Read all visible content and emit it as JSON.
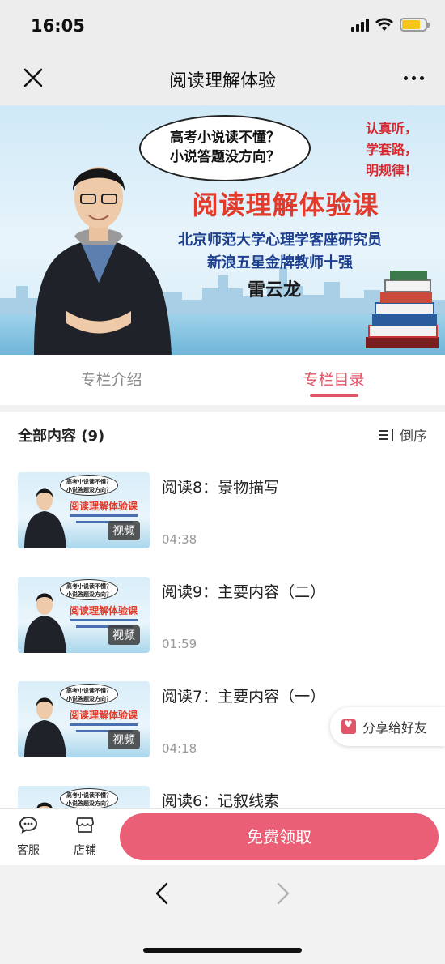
{
  "status_bar": {
    "time": "16:05",
    "signal_icon": "signal-icon",
    "wifi_icon": "wifi-icon",
    "battery_icon": "battery-icon",
    "battery_color": "#f5c518"
  },
  "nav": {
    "title": "阅读理解体验",
    "close_icon": "close-icon",
    "more_icon": "more-icon"
  },
  "banner": {
    "bubble_line1": "高考小说读不懂？",
    "bubble_line2": "小说答题没方向？",
    "side_line1": "认真听，",
    "side_line2": "学套路，",
    "side_line3": "明规律！",
    "main_title": "阅读理解体验课",
    "subtitle1": "北京师范大学心理学客座研究员",
    "subtitle2": "新浪五星金牌教师十强",
    "teacher": "雷云龙"
  },
  "tabs": [
    {
      "label": "专栏介绍",
      "active": false
    },
    {
      "label": "专栏目录",
      "active": true
    }
  ],
  "accent_color": "#e05668",
  "content": {
    "section_title": "全部内容 (9)",
    "sort_label": "倒序",
    "sort_icon": "sort-icon",
    "items": [
      {
        "title": "阅读8：景物描写",
        "duration": "04:38",
        "tag": "视频"
      },
      {
        "title": "阅读9：主要内容（二）",
        "duration": "01:59",
        "tag": "视频"
      },
      {
        "title": "阅读7：主要内容（一）",
        "duration": "04:18",
        "tag": "视频"
      },
      {
        "title": "阅读6：记叙线索",
        "duration": "",
        "tag": ""
      }
    ],
    "thumb_bubble1": "高考小说读不懂？",
    "thumb_bubble2": "小说答题没方向？",
    "thumb_title": "阅读理解体验课"
  },
  "share": {
    "label": "分享给好友",
    "icon": "share-icon"
  },
  "action_bar": {
    "service_label": "客服",
    "service_icon": "chat-icon",
    "shop_label": "店铺",
    "shop_icon": "shop-icon",
    "claim_label": "免费领取",
    "claim_color": "#ea5e76"
  },
  "browser": {
    "back_icon": "chevron-left-icon",
    "forward_icon": "chevron-right-icon"
  }
}
